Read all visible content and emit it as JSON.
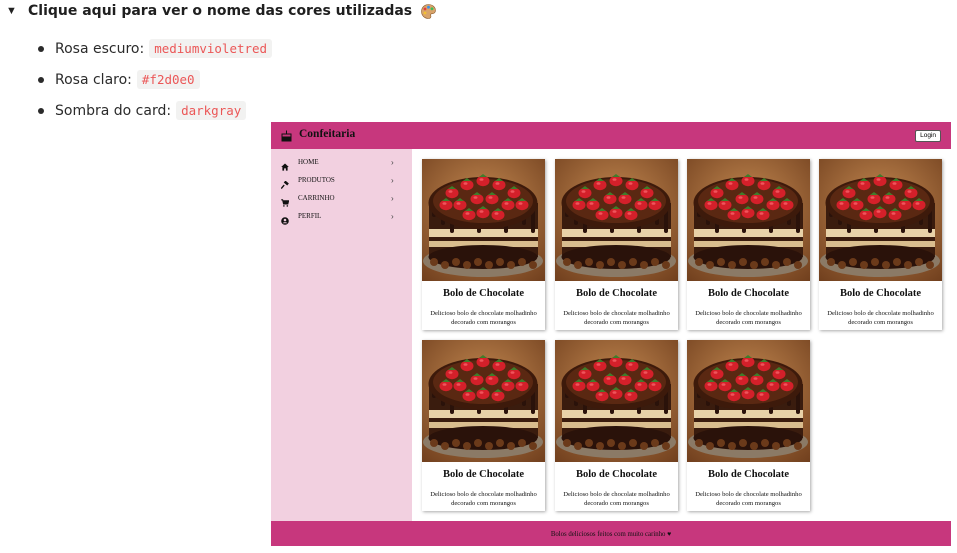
{
  "toggle": {
    "title": "Clique aqui para ver o nome das cores utilizadas",
    "emoji_icon": "artist-palette-icon",
    "items": [
      {
        "label": "Rosa escuro:",
        "code": "mediumvioletred"
      },
      {
        "label": "Rosa claro:",
        "code": "#f2d0e0"
      },
      {
        "label": "Sombra do card:",
        "code": "darkgray"
      }
    ]
  },
  "site": {
    "brand": "Confeitaria",
    "brand_icon": "cake-icon",
    "login_label": "Login",
    "nav": [
      {
        "label": "HOME",
        "icon": "home-icon"
      },
      {
        "label": "PRODUTOS",
        "icon": "hammer-icon"
      },
      {
        "label": "CARRINHO",
        "icon": "cart-icon"
      },
      {
        "label": "PERFIL",
        "icon": "account-circle-icon"
      }
    ],
    "cards": [
      {
        "title": "Bolo de Chocolate",
        "description": "Delicioso bolo de chocolate molhadinho decorado com morangos"
      },
      {
        "title": "Bolo de Chocolate",
        "description": "Delicioso bolo de chocolate molhadinho decorado com morangos"
      },
      {
        "title": "Bolo de Chocolate",
        "description": "Delicioso bolo de chocolate molhadinho decorado com morangos"
      },
      {
        "title": "Bolo de Chocolate",
        "description": "Delicioso bolo de chocolate molhadinho decorado com morangos"
      },
      {
        "title": "Bolo de Chocolate",
        "description": "Delicioso bolo de chocolate molhadinho decorado com morangos"
      },
      {
        "title": "Bolo de Chocolate",
        "description": "Delicioso bolo de chocolate molhadinho decorado com morangos"
      },
      {
        "title": "Bolo de Chocolate",
        "description": "Delicioso bolo de chocolate molhadinho decorado com morangos"
      }
    ],
    "footer_text": "Bolos deliciosos feitos com muito carinho ♥",
    "colors": {
      "header": "#c7377d",
      "sidebar": "#f2d0e0",
      "card_shadow": "darkgray"
    }
  }
}
